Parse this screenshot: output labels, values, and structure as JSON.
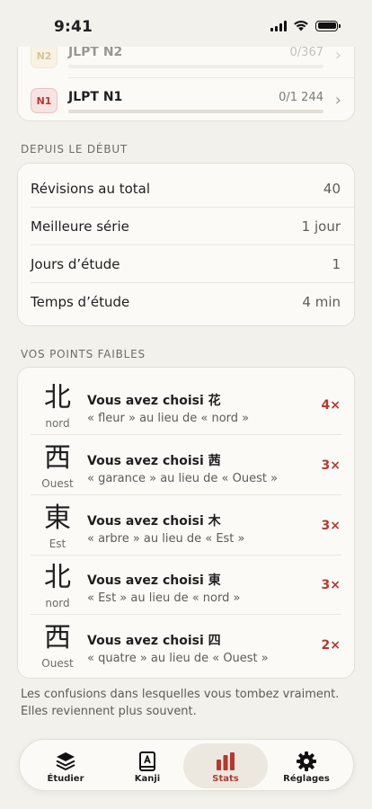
{
  "status_bar": {
    "time": "9:41"
  },
  "jlpt": [
    {
      "badge": "N2",
      "name": "JLPT N2",
      "count": "0/367",
      "progress": 0
    },
    {
      "badge": "N1",
      "name": "JLPT N1",
      "count": "0/1 244",
      "progress": 0
    }
  ],
  "since_start": {
    "heading": "DEPUIS LE DÉBUT",
    "rows": [
      {
        "label": "Révisions au total",
        "value": "40"
      },
      {
        "label": "Meilleure série",
        "value": "1 jour"
      },
      {
        "label": "Jours d’étude",
        "value": "1"
      },
      {
        "label": "Temps d’étude",
        "value": "4 min"
      }
    ]
  },
  "weak_points": {
    "heading": "VOS POINTS FAIBLES",
    "rows": [
      {
        "kanji": "北",
        "reading": "nord",
        "title": "Vous avez choisi 花",
        "sub": "« fleur » au lieu de « nord »",
        "count": "4×"
      },
      {
        "kanji": "西",
        "reading": "Ouest",
        "title": "Vous avez choisi 茜",
        "sub": "« garance » au lieu de « Ouest »",
        "count": "3×"
      },
      {
        "kanji": "東",
        "reading": "Est",
        "title": "Vous avez choisi 木",
        "sub": "« arbre » au lieu de « Est »",
        "count": "3×"
      },
      {
        "kanji": "北",
        "reading": "nord",
        "title": "Vous avez choisi 東",
        "sub": "« Est » au lieu de « nord »",
        "count": "3×"
      },
      {
        "kanji": "西",
        "reading": "Ouest",
        "title": "Vous avez choisi 四",
        "sub": "« quatre » au lieu de « Ouest »",
        "count": "2×"
      }
    ],
    "footnote_line1": "Les confusions dans lesquelles vous tombez vraiment.",
    "footnote_line2": "Elles reviennent plus souvent."
  },
  "tabbar": {
    "tabs": [
      {
        "label": "Étudier",
        "icon": "stack-icon"
      },
      {
        "label": "Kanji",
        "icon": "kanji-book-icon"
      },
      {
        "label": "Stats",
        "icon": "bar-chart-icon",
        "active": true
      },
      {
        "label": "Réglages",
        "icon": "gear-icon"
      }
    ]
  },
  "colors": {
    "accent": "#b13a32",
    "background": "#f3f1ec",
    "card": "#fbfaf7",
    "n2_badge": "#a9822f"
  }
}
